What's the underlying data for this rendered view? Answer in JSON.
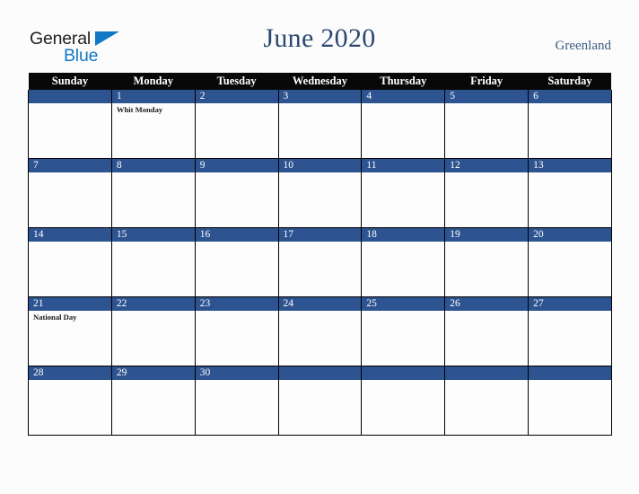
{
  "brand": {
    "name_part1": "General",
    "name_part2": "Blue",
    "triangle_icon": "triangle-icon",
    "accent_color": "#1277c4",
    "text_color": "#231f20"
  },
  "header": {
    "title": "June 2020",
    "country": "Greenland",
    "title_color": "#2b4770"
  },
  "calendar": {
    "month": "June",
    "year": "2020",
    "header_background": "#080808",
    "date_bar_color": "#2d5490",
    "weekdays": [
      "Sunday",
      "Monday",
      "Tuesday",
      "Wednesday",
      "Thursday",
      "Friday",
      "Saturday"
    ],
    "weeks": [
      [
        {
          "date": "",
          "events": []
        },
        {
          "date": "1",
          "events": [
            "Whit Monday"
          ]
        },
        {
          "date": "2",
          "events": []
        },
        {
          "date": "3",
          "events": []
        },
        {
          "date": "4",
          "events": []
        },
        {
          "date": "5",
          "events": []
        },
        {
          "date": "6",
          "events": []
        }
      ],
      [
        {
          "date": "7",
          "events": []
        },
        {
          "date": "8",
          "events": []
        },
        {
          "date": "9",
          "events": []
        },
        {
          "date": "10",
          "events": []
        },
        {
          "date": "11",
          "events": []
        },
        {
          "date": "12",
          "events": []
        },
        {
          "date": "13",
          "events": []
        }
      ],
      [
        {
          "date": "14",
          "events": []
        },
        {
          "date": "15",
          "events": []
        },
        {
          "date": "16",
          "events": []
        },
        {
          "date": "17",
          "events": []
        },
        {
          "date": "18",
          "events": []
        },
        {
          "date": "19",
          "events": []
        },
        {
          "date": "20",
          "events": []
        }
      ],
      [
        {
          "date": "21",
          "events": [
            "National Day"
          ]
        },
        {
          "date": "22",
          "events": []
        },
        {
          "date": "23",
          "events": []
        },
        {
          "date": "24",
          "events": []
        },
        {
          "date": "25",
          "events": []
        },
        {
          "date": "26",
          "events": []
        },
        {
          "date": "27",
          "events": []
        }
      ],
      [
        {
          "date": "28",
          "events": []
        },
        {
          "date": "29",
          "events": []
        },
        {
          "date": "30",
          "events": []
        },
        {
          "date": "",
          "events": []
        },
        {
          "date": "",
          "events": []
        },
        {
          "date": "",
          "events": []
        },
        {
          "date": "",
          "events": []
        }
      ]
    ]
  }
}
